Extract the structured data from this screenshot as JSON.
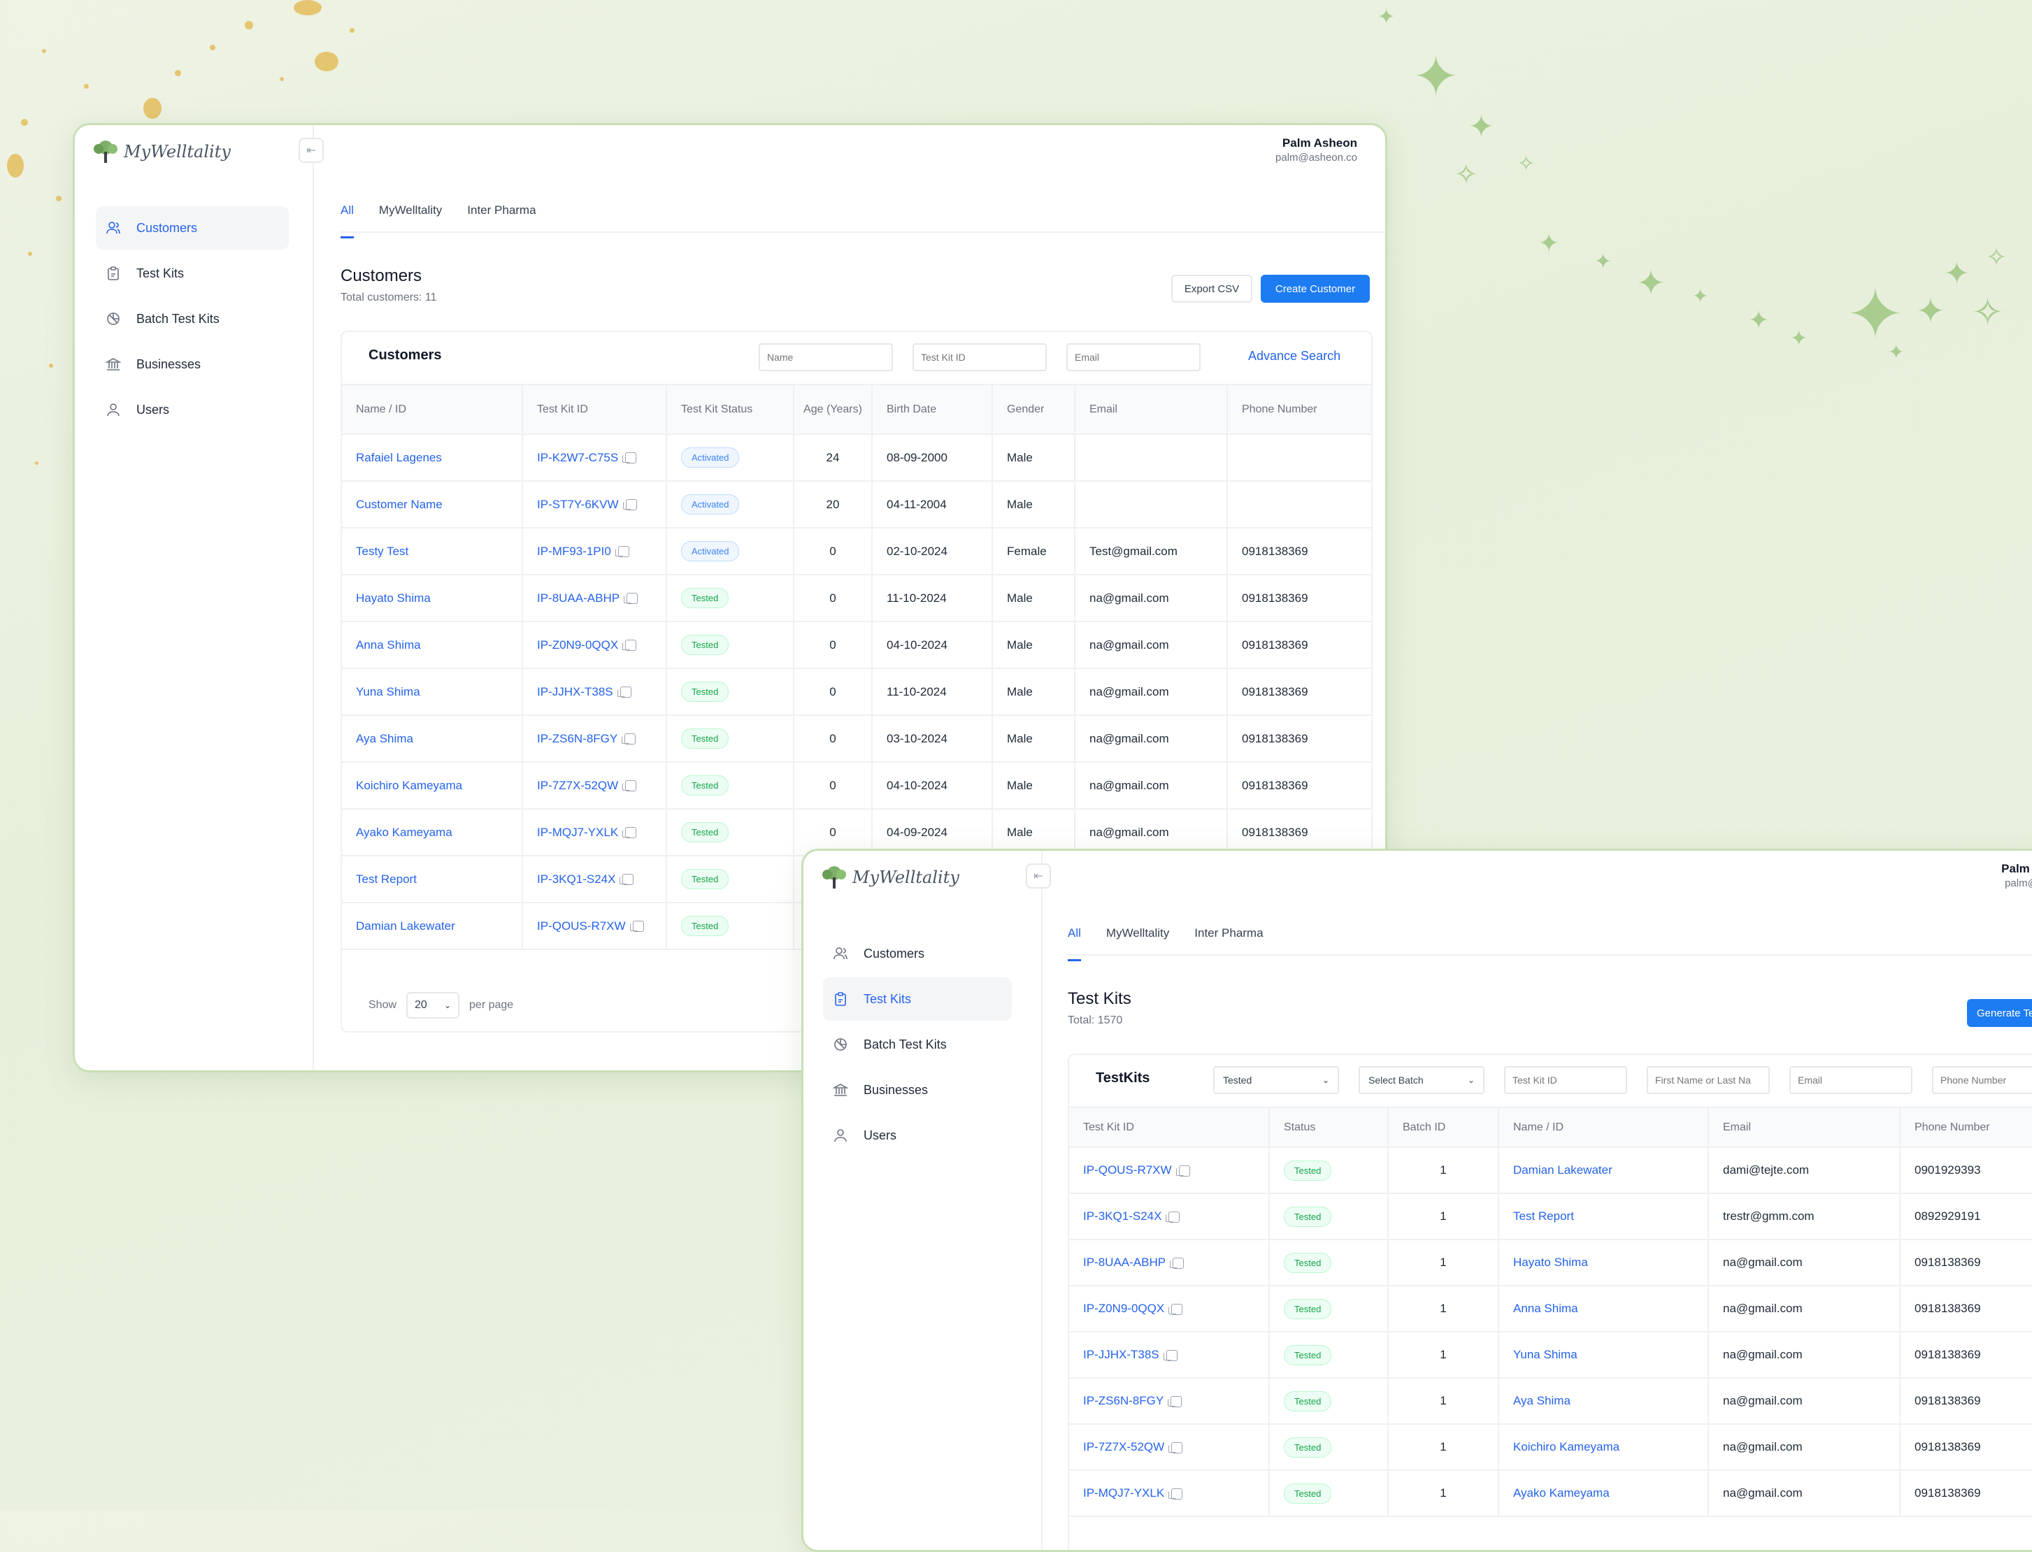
{
  "window1": {
    "logo": "MyWelltality",
    "user": {
      "name": "Palm Asheon",
      "email": "palm@asheon.co"
    },
    "nav": [
      {
        "label": "Customers",
        "icon": "users-icon"
      },
      {
        "label": "Test Kits",
        "icon": "clipboard-icon"
      },
      {
        "label": "Batch Test Kits",
        "icon": "batch-icon"
      },
      {
        "label": "Businesses",
        "icon": "bank-icon"
      },
      {
        "label": "Users",
        "icon": "user-icon"
      }
    ],
    "tabs": [
      "All",
      "MyWelltality",
      "Inter Pharma"
    ],
    "title": "Customers",
    "subtitle": "Total customers: 11",
    "export_label": "Export CSV",
    "create_label": "Create Customer",
    "card_title": "Customers",
    "filters": {
      "name": "Name",
      "kit": "Test Kit ID",
      "email": "Email"
    },
    "advance_search": "Advance Search",
    "columns": [
      "Name / ID",
      "Test Kit ID",
      "Test Kit Status",
      "Age (Years)",
      "Birth Date",
      "Gender",
      "Email",
      "Phone Number"
    ],
    "rows": [
      [
        "Rafaiel Lagenes",
        "IP-K2W7-C75S",
        "Activated",
        "24",
        "08-09-2000",
        "Male",
        "",
        ""
      ],
      [
        "Customer Name",
        "IP-ST7Y-6KVW",
        "Activated",
        "20",
        "04-11-2004",
        "Male",
        "",
        ""
      ],
      [
        "Testy Test",
        "IP-MF93-1PI0",
        "Activated",
        "0",
        "02-10-2024",
        "Female",
        "Test@gmail.com",
        "0918138369"
      ],
      [
        "Hayato Shima",
        "IP-8UAA-ABHP",
        "Tested",
        "0",
        "11-10-2024",
        "Male",
        "na@gmail.com",
        "0918138369"
      ],
      [
        "Anna Shima",
        "IP-Z0N9-0QQX",
        "Tested",
        "0",
        "04-10-2024",
        "Male",
        "na@gmail.com",
        "0918138369"
      ],
      [
        "Yuna Shima",
        "IP-JJHX-T38S",
        "Tested",
        "0",
        "11-10-2024",
        "Male",
        "na@gmail.com",
        "0918138369"
      ],
      [
        "Aya Shima",
        "IP-ZS6N-8FGY",
        "Tested",
        "0",
        "03-10-2024",
        "Male",
        "na@gmail.com",
        "0918138369"
      ],
      [
        "Koichiro Kameyama",
        "IP-7Z7X-52QW",
        "Tested",
        "0",
        "04-10-2024",
        "Male",
        "na@gmail.com",
        "0918138369"
      ],
      [
        "Ayako Kameyama",
        "IP-MQJ7-YXLK",
        "Tested",
        "0",
        "04-09-2024",
        "Male",
        "na@gmail.com",
        "0918138369"
      ],
      [
        "Test Report",
        "IP-3KQ1-S24X",
        "Tested",
        "",
        "",
        "",
        "",
        ""
      ],
      [
        "Damian Lakewater",
        "IP-QOUS-R7XW",
        "Tested",
        "",
        "",
        "",
        "",
        ""
      ]
    ],
    "pager": {
      "show": "Show",
      "value": "20",
      "per_page": "per page"
    }
  },
  "window2": {
    "logo": "MyWelltality",
    "user": {
      "name": "Palm Ash",
      "email": "palm@ash"
    },
    "nav": [
      {
        "label": "Customers",
        "icon": "users-icon"
      },
      {
        "label": "Test Kits",
        "icon": "clipboard-icon"
      },
      {
        "label": "Batch Test Kits",
        "icon": "batch-icon"
      },
      {
        "label": "Businesses",
        "icon": "bank-icon"
      },
      {
        "label": "Users",
        "icon": "user-icon"
      }
    ],
    "tabs": [
      "All",
      "MyWelltality",
      "Inter Pharma"
    ],
    "title": "Test Kits",
    "subtitle": "Total: 1570",
    "generate_label": "Generate Te",
    "card_title": "TestKits",
    "filters": {
      "status": "Tested",
      "batch": "Select Batch",
      "kit": "Test Kit ID",
      "name": "First Name or Last Na",
      "email": "Email",
      "phone": "Phone Number"
    },
    "columns": [
      "Test Kit ID",
      "Status",
      "Batch ID",
      "Name / ID",
      "Email",
      "Phone Number"
    ],
    "rows": [
      [
        "IP-QOUS-R7XW",
        "Tested",
        "1",
        "Damian Lakewater",
        "dami@tejte.com",
        "0901929393"
      ],
      [
        "IP-3KQ1-S24X",
        "Tested",
        "1",
        "Test Report",
        "trestr@gmm.com",
        "0892929191"
      ],
      [
        "IP-8UAA-ABHP",
        "Tested",
        "1",
        "Hayato Shima",
        "na@gmail.com",
        "0918138369"
      ],
      [
        "IP-Z0N9-0QQX",
        "Tested",
        "1",
        "Anna Shima",
        "na@gmail.com",
        "0918138369"
      ],
      [
        "IP-JJHX-T38S",
        "Tested",
        "1",
        "Yuna Shima",
        "na@gmail.com",
        "0918138369"
      ],
      [
        "IP-ZS6N-8FGY",
        "Tested",
        "1",
        "Aya Shima",
        "na@gmail.com",
        "0918138369"
      ],
      [
        "IP-7Z7X-52QW",
        "Tested",
        "1",
        "Koichiro Kameyama",
        "na@gmail.com",
        "0918138369"
      ],
      [
        "IP-MQJ7-YXLK",
        "Tested",
        "1",
        "Ayako Kameyama",
        "na@gmail.com",
        "0918138369"
      ]
    ]
  },
  "colors": {
    "accent": "#1d7cf2",
    "activated": "#3b82f6",
    "tested": "#16a34a",
    "frame": "#c9dfb5"
  }
}
